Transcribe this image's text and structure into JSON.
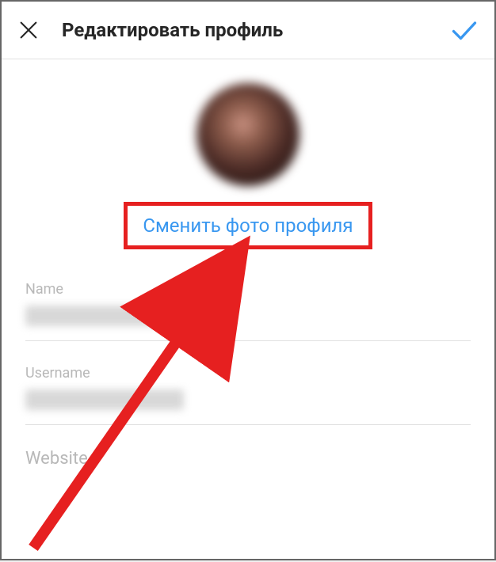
{
  "header": {
    "title": "Редактировать профиль"
  },
  "profile": {
    "change_photo_label": "Сменить фото профиля"
  },
  "fields": {
    "name_label": "Name",
    "username_label": "Username",
    "website_label": "Website"
  }
}
